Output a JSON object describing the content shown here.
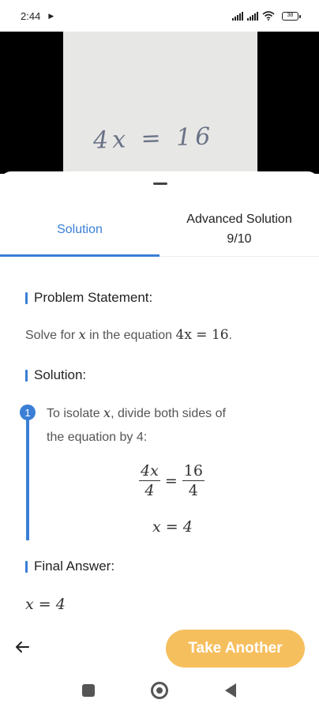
{
  "status_bar": {
    "time": "2:44",
    "battery": "38"
  },
  "preview": {
    "handwritten_equation": "4x = 16"
  },
  "tabs": [
    {
      "label": "Solution",
      "active": true
    },
    {
      "label": "Advanced Solution",
      "sublabel": "9/10",
      "active": false
    }
  ],
  "problem": {
    "title": "Problem Statement:",
    "text_before": "Solve for ",
    "variable": "x",
    "text_middle": " in the equation ",
    "equation": "4x = 16",
    "text_after": "."
  },
  "solution": {
    "title": "Solution:",
    "step_number": "1",
    "line1_before": "To isolate ",
    "line1_var": "x",
    "line1_after": ", divide both sides of",
    "line2": "the equation by 4:",
    "frac_left_num": "4x",
    "frac_left_den": "4",
    "equals": "=",
    "frac_right_num": "16",
    "frac_right_den": "4",
    "result": "x = 4"
  },
  "final": {
    "title": "Final Answer:",
    "answer": "x = 4"
  },
  "actions": {
    "take_another": "Take Another"
  },
  "colors": {
    "accent": "#3a7fd5",
    "button": "#f6bf5e"
  }
}
